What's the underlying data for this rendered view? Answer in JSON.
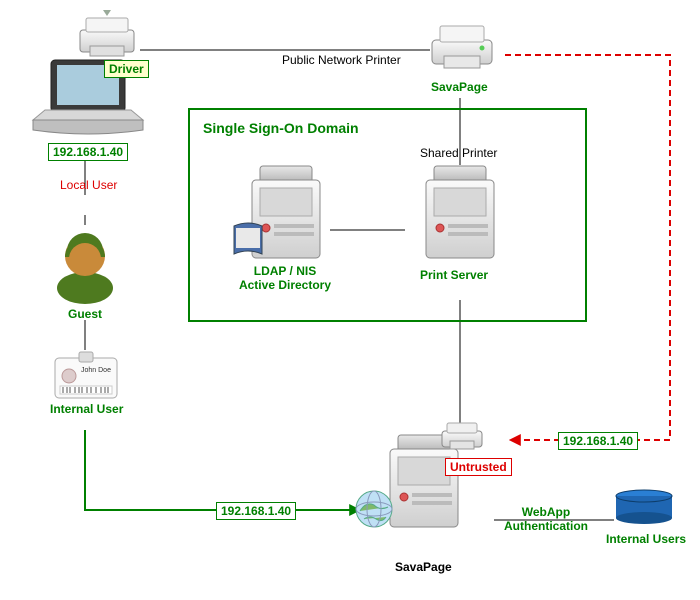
{
  "public_network_printer": "Public Network Printer",
  "savapage_printer": "SavaPage",
  "driver": "Driver",
  "laptop_ip": "192.168.1.40",
  "local_user": "Local User",
  "guest": "Guest",
  "id_card_name": "John Doe",
  "internal_user": "Internal User",
  "sso_title": "Single Sign-On Domain",
  "shared_printer": "Shared Printer",
  "ldap": "LDAP / NIS\nActive Directory",
  "print_server": "Print Server",
  "untrusted": "Untrusted",
  "flow_ip_left": "192.168.1.40",
  "flow_ip_right": "192.168.1.40",
  "savapage_server": "SavaPage",
  "webapp_auth": "WebApp\nAuthentication",
  "internal_users_db": "Internal Users"
}
